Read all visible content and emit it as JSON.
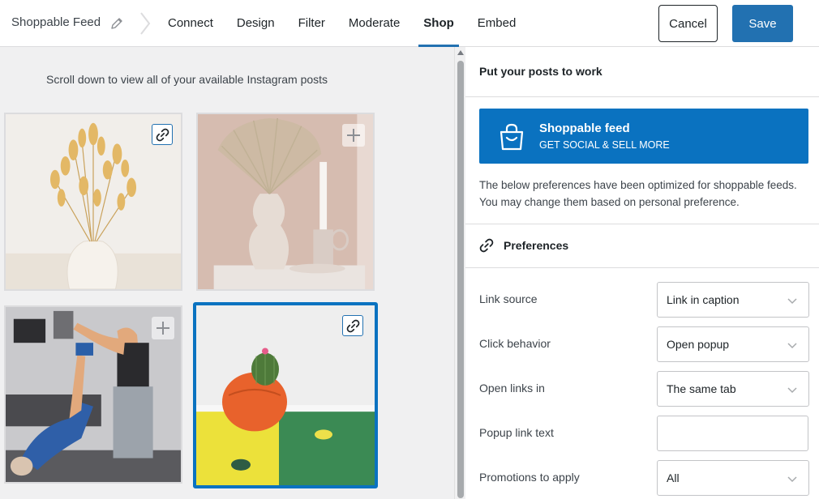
{
  "header": {
    "feed_title": "Shoppable Feed",
    "tabs": [
      "Connect",
      "Design",
      "Filter",
      "Moderate",
      "Shop",
      "Embed"
    ],
    "active_tab": "Shop",
    "cancel_label": "Cancel",
    "save_label": "Save",
    "accent_color": "#2271b1"
  },
  "left_panel": {
    "hint": "Scroll down to view all of your available Instagram posts",
    "posts": [
      {
        "subject": "dried bunny-tail grass in white vase",
        "state": "linked",
        "selected": false
      },
      {
        "subject": "dried palm leaf vase with candle",
        "state": "add",
        "selected": false
      },
      {
        "subject": "gym partner workout",
        "state": "add",
        "selected": false
      },
      {
        "subject": "cactus in orange pot",
        "state": "linked",
        "selected": true
      }
    ]
  },
  "right_panel": {
    "section_title": "Put your posts to work",
    "promo": {
      "title": "Shoppable feed",
      "subtitle": "GET SOCIAL & SELL MORE",
      "color": "#0a72c0",
      "icon": "shopping-bag-icon"
    },
    "description": "The below preferences have been optimized for shoppable feeds. You may change them based on personal preference.",
    "preferences_title": "Preferences",
    "preferences_icon": "link-icon",
    "settings": [
      {
        "label": "Link source",
        "value": "Link in caption",
        "type": "select"
      },
      {
        "label": "Click behavior",
        "value": "Open popup",
        "type": "select"
      },
      {
        "label": "Open links in",
        "value": "The same tab",
        "type": "select"
      },
      {
        "label": "Popup link text",
        "value": "",
        "type": "text"
      },
      {
        "label": "Promotions to apply",
        "value": "All",
        "type": "select"
      }
    ]
  }
}
